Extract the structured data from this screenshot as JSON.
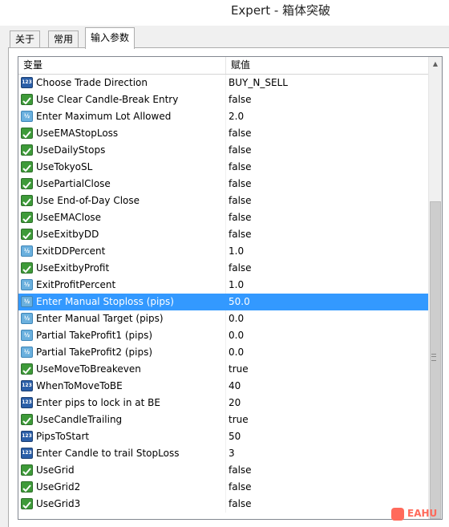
{
  "window": {
    "title": "Expert - 箱体突破"
  },
  "tabs": [
    {
      "label": "关于"
    },
    {
      "label": "常用"
    },
    {
      "label": "输入参数"
    }
  ],
  "grid": {
    "headers": {
      "variable": "变量",
      "value": "赋值"
    },
    "rows": [
      {
        "icon": "integer-icon",
        "name": "Choose Trade Direction",
        "value": "BUY_N_SELL"
      },
      {
        "icon": "boolean-icon",
        "name": "Use Clear Candle-Break Entry",
        "value": "false"
      },
      {
        "icon": "double-icon",
        "name": "Enter Maximum Lot Allowed",
        "value": "2.0"
      },
      {
        "icon": "boolean-icon",
        "name": "UseEMAStopLoss",
        "value": "false"
      },
      {
        "icon": "boolean-icon",
        "name": "UseDailyStops",
        "value": "false"
      },
      {
        "icon": "boolean-icon",
        "name": "UseTokyoSL",
        "value": "false"
      },
      {
        "icon": "boolean-icon",
        "name": "UsePartialClose",
        "value": "false"
      },
      {
        "icon": "boolean-icon",
        "name": "Use End-of-Day Close",
        "value": "false"
      },
      {
        "icon": "boolean-icon",
        "name": "UseEMAClose",
        "value": "false"
      },
      {
        "icon": "boolean-icon",
        "name": "UseExitbyDD",
        "value": "false"
      },
      {
        "icon": "double-icon",
        "name": "ExitDDPercent",
        "value": "1.0"
      },
      {
        "icon": "boolean-icon",
        "name": "UseExitbyProfit",
        "value": "false"
      },
      {
        "icon": "double-icon",
        "name": "ExitProfitPercent",
        "value": "1.0"
      },
      {
        "icon": "double-icon",
        "name": "Enter Manual Stoploss (pips)",
        "value": "50.0",
        "selected": true
      },
      {
        "icon": "double-icon",
        "name": "Enter Manual Target (pips)",
        "value": "0.0"
      },
      {
        "icon": "double-icon",
        "name": "Partial TakeProfit1 (pips)",
        "value": "0.0"
      },
      {
        "icon": "double-icon",
        "name": "Partial TakeProfit2 (pips)",
        "value": "0.0"
      },
      {
        "icon": "boolean-icon",
        "name": "UseMoveToBreakeven",
        "value": "true"
      },
      {
        "icon": "integer-icon",
        "name": "WhenToMoveToBE",
        "value": "40"
      },
      {
        "icon": "integer-icon",
        "name": "Enter pips to lock in at BE",
        "value": "20"
      },
      {
        "icon": "boolean-icon",
        "name": "UseCandleTrailing",
        "value": "true"
      },
      {
        "icon": "integer-icon",
        "name": "PipsToStart",
        "value": "50"
      },
      {
        "icon": "integer-icon",
        "name": "Enter Candle to trail StopLoss",
        "value": "3"
      },
      {
        "icon": "boolean-icon",
        "name": "UseGrid",
        "value": "false"
      },
      {
        "icon": "boolean-icon",
        "name": "UseGrid2",
        "value": "false"
      },
      {
        "icon": "boolean-icon",
        "name": "UseGrid3",
        "value": "false"
      }
    ]
  },
  "icon_glyphs": {
    "integer": "123",
    "double": "½"
  },
  "watermark": {
    "text": "EAHU"
  },
  "colors": {
    "selection": "#3399ff",
    "boolean_icon": "#3e9a39",
    "integer_icon": "#2b5fa8",
    "double_icon": "#6ab0de"
  }
}
